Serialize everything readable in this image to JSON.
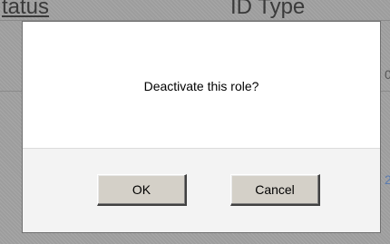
{
  "background": {
    "header": {
      "status_label": "tatus",
      "id_type_label": "ID Type"
    },
    "edge_chars": [
      "0",
      "2"
    ]
  },
  "dialog": {
    "message": "Deactivate this role?",
    "ok_label": "OK",
    "cancel_label": "Cancel"
  },
  "colors": {
    "overlay": "#9d9d9d",
    "dialog_body": "#ffffff",
    "dialog_footer": "#f3f3f3",
    "button_face": "#d4d0c8"
  }
}
